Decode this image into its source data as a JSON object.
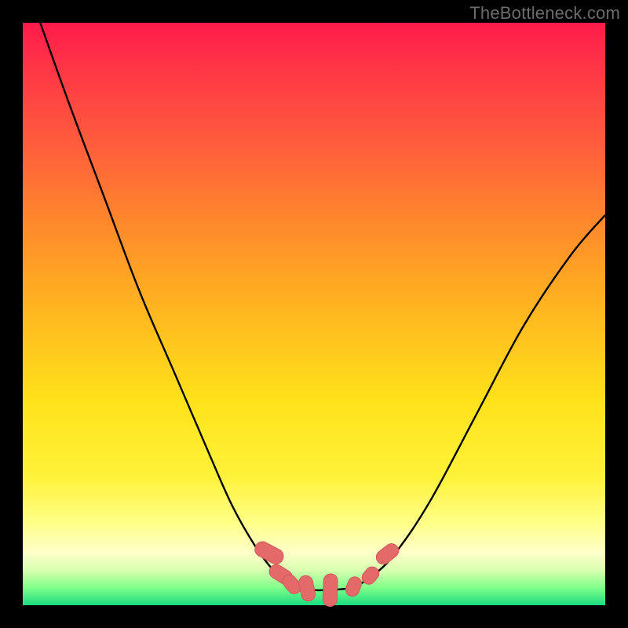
{
  "watermark": {
    "text": "TheBottleneck.com"
  },
  "colors": {
    "curve_stroke": "#000000",
    "marker_fill": "#e46a6a",
    "marker_stroke": "#cf5a5a",
    "background_black": "#000000"
  },
  "chart_data": {
    "type": "line",
    "title": "",
    "xlabel": "",
    "ylabel": "",
    "xlim": [
      0,
      100
    ],
    "ylim": [
      0,
      100
    ],
    "note": "Image has no visible axes or tick labels; values are positional estimates in 0–100 normalized coords (y=0 bottom, y=100 top).",
    "series": [
      {
        "name": "left-branch",
        "x": [
          3,
          8,
          14,
          20,
          26,
          32,
          36,
          40,
          43,
          45,
          46.5,
          48
        ],
        "y": [
          100,
          86,
          70,
          54,
          40,
          26,
          17,
          10,
          6,
          4,
          3,
          3
        ],
        "markers": false
      },
      {
        "name": "valley-floor",
        "x": [
          48,
          50,
          52,
          54,
          56,
          57
        ],
        "y": [
          3,
          2.6,
          2.6,
          2.7,
          2.9,
          3.2
        ],
        "markers": false
      },
      {
        "name": "right-branch",
        "x": [
          57,
          60,
          64,
          70,
          78,
          86,
          94,
          100
        ],
        "y": [
          3.2,
          5,
          9,
          18,
          33,
          48,
          60,
          67
        ],
        "markers": false
      }
    ],
    "markers": [
      {
        "shape": "pill",
        "cx": 42.3,
        "cy": 9.0,
        "w": 2.6,
        "h": 5.2,
        "angle": -62
      },
      {
        "shape": "pill",
        "cx": 44.3,
        "cy": 5.3,
        "w": 2.4,
        "h": 4.2,
        "angle": -58
      },
      {
        "shape": "pill",
        "cx": 46.2,
        "cy": 3.6,
        "w": 2.3,
        "h": 3.6,
        "angle": -40
      },
      {
        "shape": "pill",
        "cx": 48.8,
        "cy": 2.9,
        "w": 2.4,
        "h": 4.4,
        "angle": -12
      },
      {
        "shape": "pill",
        "cx": 52.8,
        "cy": 2.6,
        "w": 2.4,
        "h": 5.6,
        "angle": 2
      },
      {
        "shape": "pill",
        "cx": 56.8,
        "cy": 3.2,
        "w": 2.3,
        "h": 3.4,
        "angle": 22
      },
      {
        "shape": "pill",
        "cx": 59.7,
        "cy": 5.1,
        "w": 2.3,
        "h": 3.2,
        "angle": 40
      },
      {
        "shape": "pill",
        "cx": 62.6,
        "cy": 8.8,
        "w": 2.4,
        "h": 4.2,
        "angle": 52
      }
    ]
  }
}
